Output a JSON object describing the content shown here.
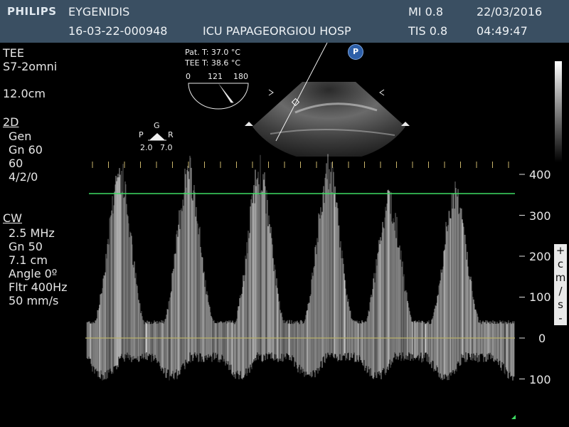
{
  "header": {
    "brand": "PHILIPS",
    "patient_name": "EYGENIDIS",
    "patient_id": "16-03-22-000948",
    "hospital": "ICU PAPAGEORGIOU HOSP",
    "mi": "MI 0.8",
    "tis": "TIS 0.8",
    "date": "22/03/2016",
    "time": "04:49:47"
  },
  "probe": {
    "mode": "TEE",
    "transducer": "S7-2omni",
    "depth": "12.0cm"
  },
  "panel_2d": {
    "title": "2D",
    "lines": [
      "Gen",
      "Gn 60",
      "60",
      "4/2/0"
    ]
  },
  "panel_cw": {
    "title": "CW",
    "lines": [
      "2.5 MHz",
      "Gn 50",
      "7.1 cm",
      "Angle 0º",
      "Fltr 400Hz",
      "50 mm/s"
    ]
  },
  "temps": {
    "patient": "Pat. T: 37.0 °C",
    "tee": "TEE T: 38.6 °C"
  },
  "dial": {
    "min": "0",
    "current": "121",
    "max": "180",
    "angle_deg": 121
  },
  "focus": {
    "g": "G",
    "p": "P",
    "r": "R",
    "left_value": "2.0",
    "right_value": "7.0"
  },
  "badge": "P",
  "doppler_scale": {
    "labels": [
      "400",
      "300",
      "200",
      "100",
      "0",
      "100"
    ],
    "units": [
      "+",
      "c",
      "m",
      "/",
      "s",
      "-"
    ],
    "velocity_line_cm_s": 353
  },
  "colors": {
    "header_bg": "#3a4f62",
    "velocity_line": "#3ddc63",
    "baseline": "#b8b06a"
  }
}
